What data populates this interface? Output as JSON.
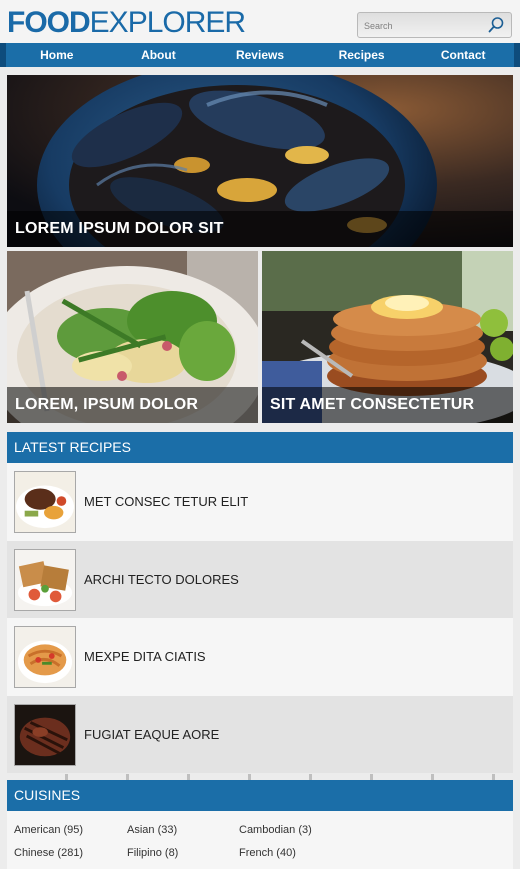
{
  "logo": {
    "part1": "FOOD",
    "part2": "EXPLORER"
  },
  "search": {
    "placeholder": "Search"
  },
  "nav": [
    "Home",
    "About",
    "Reviews",
    "Recipes",
    "Contact"
  ],
  "hero": [
    {
      "caption": "LOREM IPSUM DOLOR SIT",
      "image": "mussels-photo"
    },
    {
      "caption": "LOREM, IPSUM DOLOR",
      "image": "salad-photo"
    },
    {
      "caption": "SIT AMET CONSECTETUR",
      "image": "pancakes-photo"
    }
  ],
  "latest": {
    "title": "LATEST RECIPES",
    "items": [
      {
        "title": "MET CONSEC TETUR ELIT",
        "image": "steak-plate-thumb"
      },
      {
        "title": "ARCHI TECTO DOLORES",
        "image": "sandwich-thumb"
      },
      {
        "title": "MEXPE DITA CIATIS",
        "image": "pasta-thumb"
      },
      {
        "title": "FUGIAT EAQUE AORE",
        "image": "grilled-steak-thumb"
      }
    ]
  },
  "cuisines": {
    "title": "CUISINES",
    "items": [
      "American (95)",
      "Asian (33)",
      "Cambodian (3)",
      "Chinese (281)",
      "Filipino (8)",
      "French (40)"
    ]
  },
  "colors": {
    "brand": "#1b6ea8",
    "brand_dark": "#0e4c7c"
  }
}
